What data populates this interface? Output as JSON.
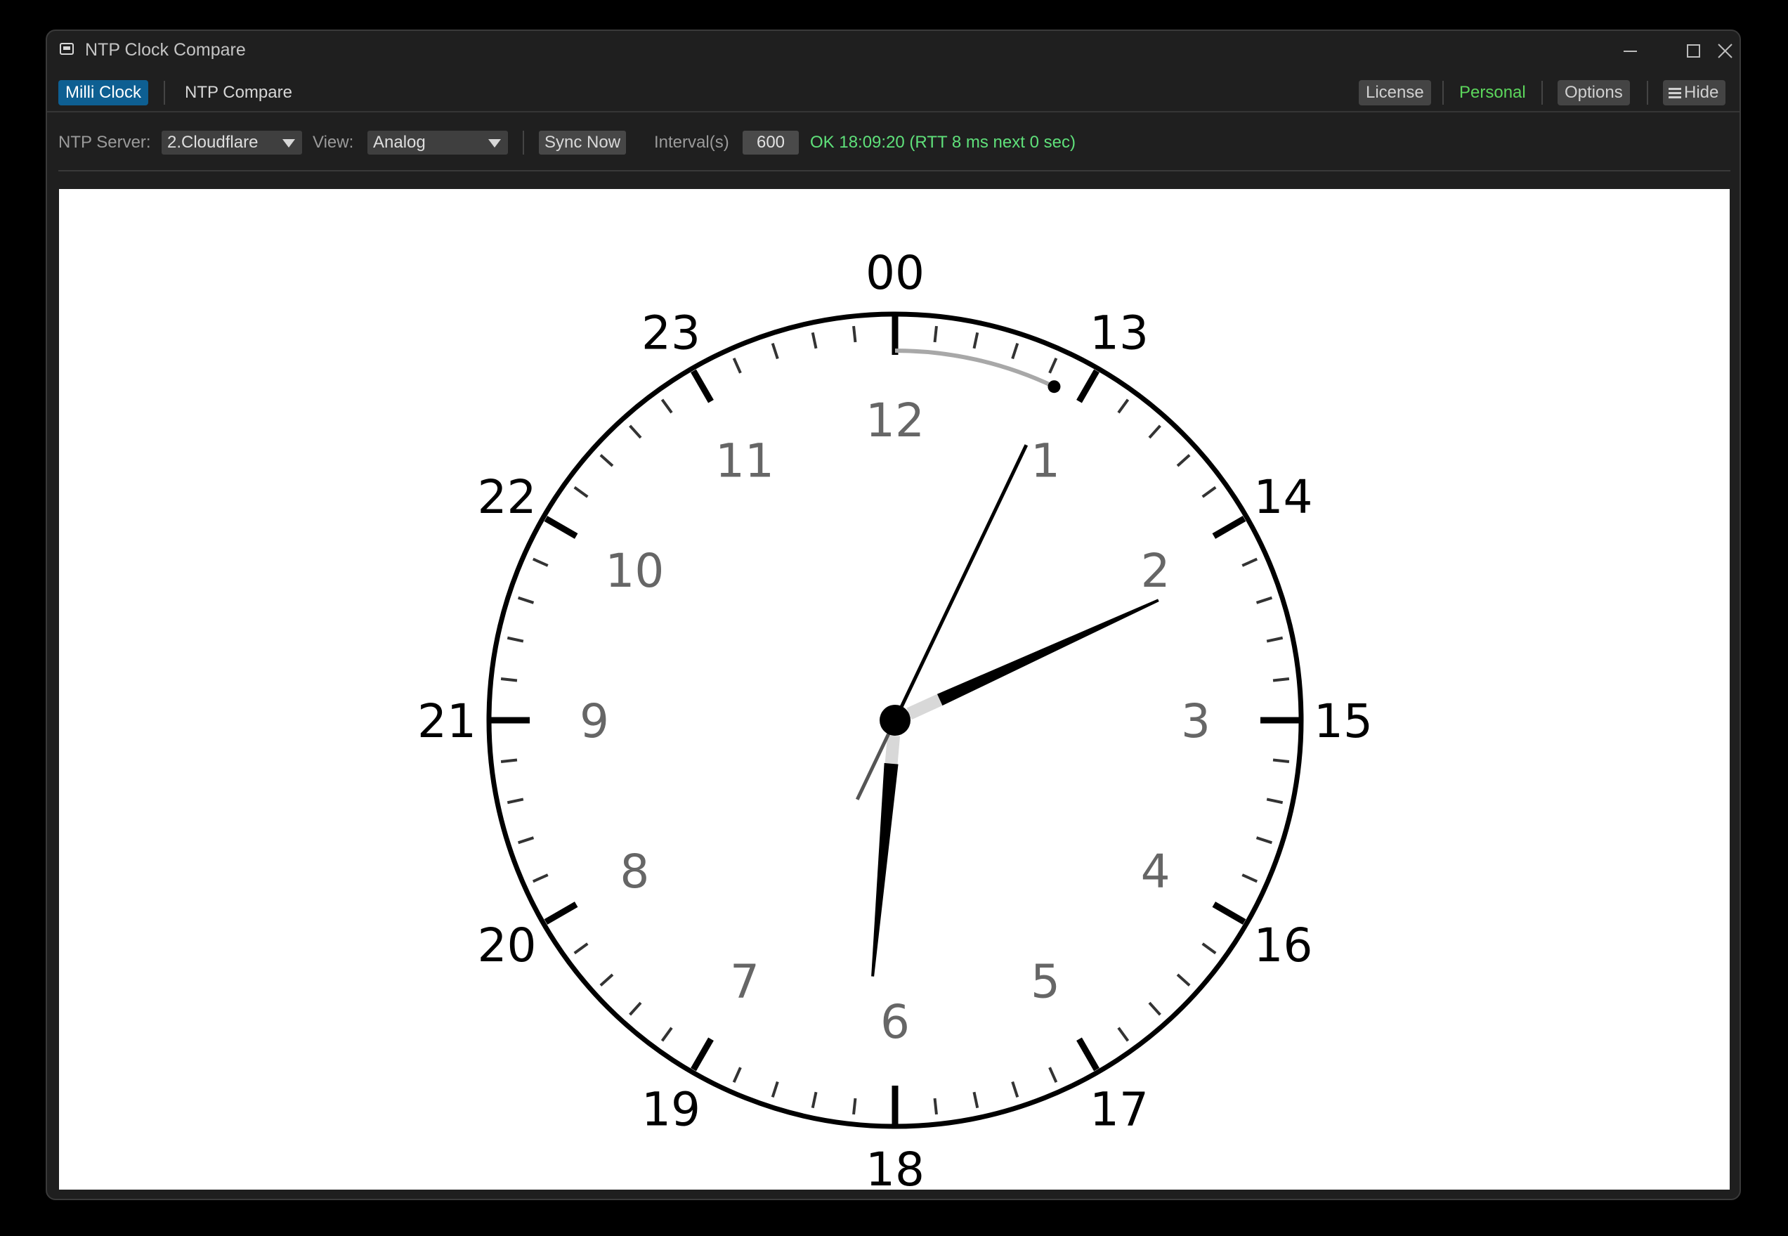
{
  "window": {
    "title": "NTP Clock Compare",
    "controls": {
      "minimize": "minimize-icon",
      "maximize": "maximize-icon",
      "close": "close-icon"
    }
  },
  "tabs": [
    {
      "label": "Milli Clock",
      "active": true
    },
    {
      "label": "NTP Compare",
      "active": false
    }
  ],
  "header_right": {
    "license": "License",
    "personal": "Personal",
    "options": "Options",
    "hide": "Hide"
  },
  "toolbar": {
    "ntp_server_label": "NTP Server:",
    "ntp_server_value": "2.Cloudflare",
    "view_label": "View:",
    "view_value": "Analog",
    "sync_button": "Sync Now",
    "interval_label": "Interval(s)",
    "interval_value": "600",
    "status": "OK 18:09:20 (RTT 8 ms  next 0 sec)"
  },
  "clock": {
    "outer_numerals": [
      "00",
      "13",
      "14",
      "15",
      "16",
      "17",
      "18",
      "19",
      "20",
      "21",
      "22",
      "23"
    ],
    "inner_numerals": [
      "12",
      "1",
      "2",
      "3",
      "4",
      "5",
      "6",
      "7",
      "8",
      "9",
      "10",
      "11"
    ],
    "hour_hand_deg": 65.5,
    "minute_hand_deg": 185,
    "second_hand_deg": 25.5,
    "seconds_arc_deg": 25.5
  },
  "colors": {
    "accent": "#0e5f92",
    "status_green": "#5fe07a",
    "personal_green": "#5cd65c",
    "inner_numeral": "#666666"
  }
}
